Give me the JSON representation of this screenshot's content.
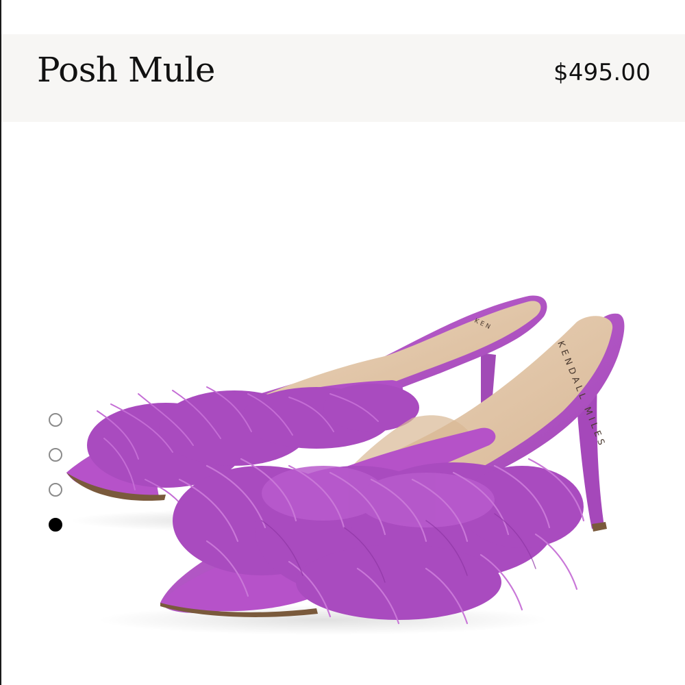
{
  "product": {
    "title": "Posh Mule",
    "price": "$495.00"
  },
  "image": {
    "brand_print": "KENDALL MILES",
    "colors": {
      "satin": "#b552c8",
      "satin_dark": "#8e32a3",
      "feather": "#a94bbf",
      "feather_light": "#c66fd6",
      "insole": "#e3c7a8",
      "insole_shadow": "#cfae8b",
      "heel_sole": "#7a5a3c"
    }
  },
  "carousel": {
    "total_slides": 4,
    "active_slide": 4
  }
}
